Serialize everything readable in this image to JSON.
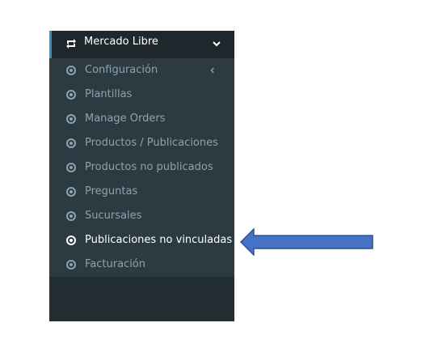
{
  "sidebar": {
    "header": {
      "label": "Mercado Libre",
      "icon": "retweet-icon",
      "expand_icon": "chevron-down-icon"
    },
    "items": [
      {
        "label": "Configuración",
        "has_children": true
      },
      {
        "label": "Plantillas"
      },
      {
        "label": "Manage Orders"
      },
      {
        "label": "Productos / Publicaciones"
      },
      {
        "label": "Productos no publicados"
      },
      {
        "label": "Preguntas"
      },
      {
        "label": "Sucursales"
      },
      {
        "label": "Publicaciones no vinculadas",
        "active": true
      },
      {
        "label": "Facturación"
      }
    ]
  },
  "annotation": {
    "icon": "left-arrow-icon",
    "color": "#4472c4",
    "target": "Publicaciones no vinculadas"
  },
  "colors": {
    "sidebar_bg": "#222d32",
    "submenu_bg": "#2c3b41",
    "header_bg": "#1e282c",
    "accent": "#3c8dbc",
    "muted_text": "#8aa4af"
  }
}
